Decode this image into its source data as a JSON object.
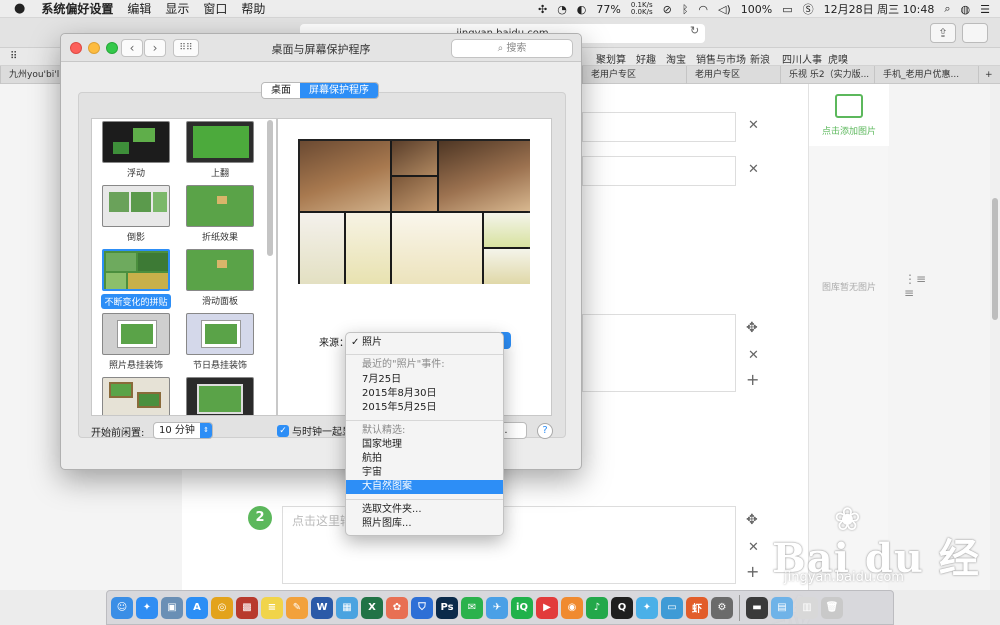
{
  "menubar": {
    "app_name": "系统偏好设置",
    "menus": [
      "编辑",
      "显示",
      "窗口",
      "帮助"
    ],
    "net_up": "0.1K/s",
    "net_down": "0.0K/s",
    "cpu": "77%",
    "battery": "100%",
    "datetime": "12月28日 周三  10:48"
  },
  "browser": {
    "url": "jingyan.baidu.com",
    "bookmarks": [
      "聚划算",
      "好趣",
      "淘宝",
      "销售与市场",
      "新浪",
      "四川人事",
      "虎嗅"
    ],
    "tabs": [
      "九州you'bi'l",
      "老用户专区",
      "老用户专区",
      "乐视 乐2（实力版...",
      "手机_老用户优惠..."
    ],
    "add_picture": "点击添加图片",
    "no_picture": "图库暂无图片",
    "step_number": "2",
    "step_placeholder": "点击这里输"
  },
  "prefs": {
    "title": "桌面与屏幕保护程序",
    "search_placeholder": "搜索",
    "tabs": [
      {
        "label": "桌面",
        "selected": false
      },
      {
        "label": "屏幕保护程序",
        "selected": true
      }
    ],
    "savers": [
      {
        "label": "浮动",
        "selected": false
      },
      {
        "label": "上翻",
        "selected": false
      },
      {
        "label": "倒影",
        "selected": false
      },
      {
        "label": "折纸效果",
        "selected": false
      },
      {
        "label": "不断变化的拼贴",
        "selected": true
      },
      {
        "label": "滑动面板",
        "selected": false
      },
      {
        "label": "照片悬挂装饰",
        "selected": false
      },
      {
        "label": "节日悬挂装饰",
        "selected": false
      },
      {
        "label": "",
        "selected": false
      },
      {
        "label": "",
        "selected": false
      }
    ],
    "source_label": "来源：",
    "idle_label": "开始前闲置:",
    "idle_value": "10 分钟",
    "clock_label": "与时钟一起显",
    "clock_checked": true,
    "options_button": "...",
    "help_button": "?"
  },
  "source_menu": {
    "checked_item": "照片",
    "recent_header": "最近的\"照片\"事件:",
    "recent_events": [
      "7月25日",
      "2015年8月30日",
      "2015年5月25日"
    ],
    "featured_header": "默认精选:",
    "featured": [
      "国家地理",
      "航拍",
      "宇宙",
      "大自然图案"
    ],
    "highlighted": "大自然图案",
    "choose_folder": "选取文件夹...",
    "photo_library": "照片图库..."
  },
  "watermark": {
    "brand": "Bai du 经验",
    "url": "jingyan.baidu.com"
  },
  "colors": {
    "accent": "#2d8ef6",
    "green": "#5cb85c"
  },
  "dock": [
    {
      "name": "finder-icon",
      "glyph": "☺",
      "color": "#3a8ee6"
    },
    {
      "name": "safari-icon",
      "glyph": "✦",
      "color": "#2f8df3"
    },
    {
      "name": "preview-icon",
      "glyph": "▣",
      "color": "#6a8fb5"
    },
    {
      "name": "app-store-icon",
      "glyph": "A",
      "color": "#2b8ef5"
    },
    {
      "name": "chrome-icon",
      "glyph": "◎",
      "color": "#e3a31c"
    },
    {
      "name": "game-icon",
      "glyph": "▩",
      "color": "#b83a2d"
    },
    {
      "name": "notes-icon",
      "glyph": "≡",
      "color": "#f1d44a"
    },
    {
      "name": "pages-icon",
      "glyph": "✎",
      "color": "#f2a13b"
    },
    {
      "name": "word-icon",
      "glyph": "W",
      "color": "#2b5aa8"
    },
    {
      "name": "keynote-icon",
      "glyph": "▦",
      "color": "#4aa3e0"
    },
    {
      "name": "excel-icon",
      "glyph": "X",
      "color": "#217346"
    },
    {
      "name": "photos-icon",
      "glyph": "✿",
      "color": "#e86f53"
    },
    {
      "name": "shield-icon",
      "glyph": "⛉",
      "color": "#2d6fd6"
    },
    {
      "name": "photoshop-icon",
      "glyph": "Ps",
      "color": "#0b2a4a"
    },
    {
      "name": "wechat-icon",
      "glyph": "✉",
      "color": "#2bb24c"
    },
    {
      "name": "plane-icon",
      "glyph": "✈",
      "color": "#4aa0e6"
    },
    {
      "name": "iqiyi-icon",
      "glyph": "iQ",
      "color": "#20b24b"
    },
    {
      "name": "video-icon",
      "glyph": "▶",
      "color": "#e23b3b"
    },
    {
      "name": "player-icon",
      "glyph": "◉",
      "color": "#f08a2f"
    },
    {
      "name": "music-icon",
      "glyph": "♪",
      "color": "#23a84a"
    },
    {
      "name": "qq-icon",
      "glyph": "Q",
      "color": "#1f1f1f"
    },
    {
      "name": "twitter-icon",
      "glyph": "✦",
      "color": "#4ab0e8"
    },
    {
      "name": "monitor-icon",
      "glyph": "▭",
      "color": "#3f9bd6"
    },
    {
      "name": "xia-icon",
      "glyph": "虾",
      "color": "#e25d2a"
    },
    {
      "name": "system-preferences-icon",
      "glyph": "⚙",
      "color": "#6b6b6b"
    },
    {
      "name": "screen-icon",
      "glyph": "▬",
      "color": "#3a3a3a"
    },
    {
      "name": "folder-icon",
      "glyph": "▤",
      "color": "#6fb3e8"
    },
    {
      "name": "document-icon",
      "glyph": "▥",
      "color": "#d8d8d8"
    },
    {
      "name": "trash-icon",
      "glyph": "🗑",
      "color": "#c9c9c9"
    }
  ]
}
